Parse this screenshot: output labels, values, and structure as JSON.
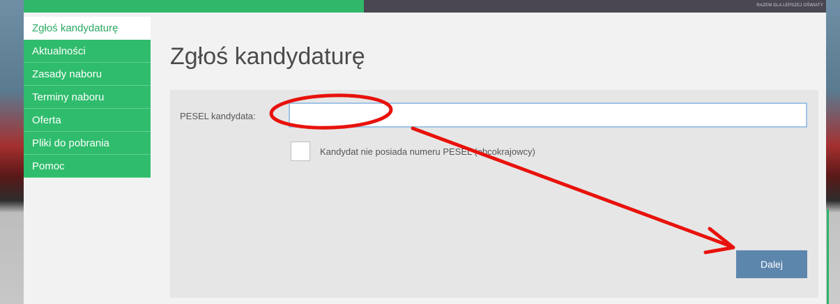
{
  "header": {
    "tagline": "RAZEM DLA LEPSZEJ OŚWIATY"
  },
  "sidebar": {
    "items": [
      {
        "label": "Zgłoś kandydaturę",
        "active": true
      },
      {
        "label": "Aktualności"
      },
      {
        "label": "Zasady naboru"
      },
      {
        "label": "Terminy naboru"
      },
      {
        "label": "Oferta"
      },
      {
        "label": "Pliki do pobrania"
      },
      {
        "label": "Pomoc"
      }
    ]
  },
  "main": {
    "title": "Zgłoś kandydaturę",
    "form": {
      "pesel_label": "PESEL kandydata:",
      "pesel_value": "",
      "no_pesel_label": "Kandydat nie posiada numeru PESEL (obcokrajowcy)",
      "no_pesel_checked": false,
      "next_label": "Dalej"
    }
  },
  "colors": {
    "nav_green": "#2fbc6c",
    "button_blue": "#5d86ad",
    "annotation_red": "#e8120c"
  }
}
